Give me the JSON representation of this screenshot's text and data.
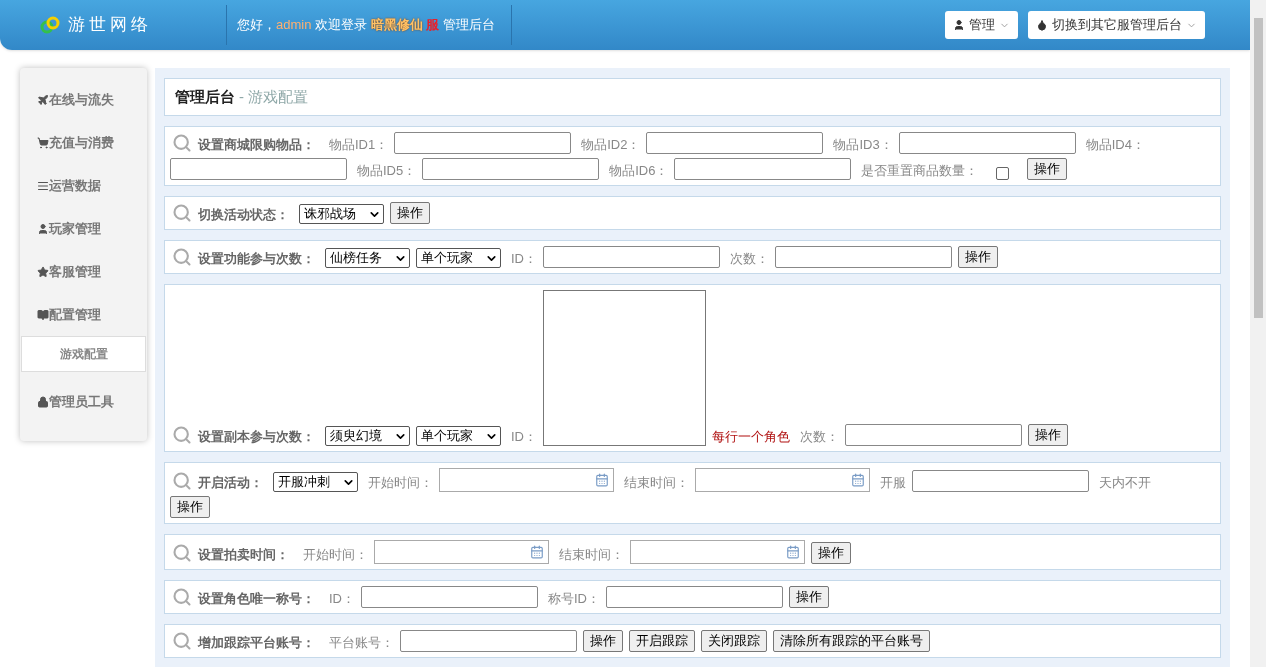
{
  "header": {
    "logo": "游世网络",
    "greeting": [
      {
        "kind": "plain",
        "text": "您好，"
      },
      {
        "kind": "user",
        "text": "admin"
      },
      {
        "kind": "plain",
        "text": " 欢迎登录 "
      },
      {
        "kind": "server",
        "text": "暗黑修仙"
      },
      {
        "kind": "alert",
        "text": " 服"
      },
      {
        "kind": "plain",
        "text": " 管理后台"
      }
    ],
    "menus": [
      "管理",
      "切换到其它服管理后台"
    ]
  },
  "sidebar": {
    "items": [
      {
        "label": "在线与流失",
        "selected": false
      },
      {
        "label": "充值与消费",
        "selected": false
      },
      {
        "label": "运营数据",
        "selected": false
      },
      {
        "label": "玩家管理",
        "selected": false
      },
      {
        "label": "客服管理",
        "selected": false
      },
      {
        "label": "配置管理",
        "selected": false,
        "children": [
          {
            "label": "游戏配置",
            "selected": true
          }
        ]
      },
      {
        "label": "管理员工具",
        "selected": false
      }
    ]
  },
  "breadcrumb": {
    "root": "管理后台",
    "current": "- 游戏配置"
  },
  "forms": [
    {
      "title": "设置商城限购物品：",
      "items": [
        {
          "kind": "label",
          "text": "物品ID1："
        },
        {
          "kind": "input"
        },
        {
          "kind": "label",
          "text": "物品ID2："
        },
        {
          "kind": "input"
        },
        {
          "kind": "label",
          "text": "物品ID3："
        },
        {
          "kind": "input"
        },
        {
          "kind": "label",
          "text": "物品ID4："
        },
        {
          "kind": "break"
        },
        {
          "kind": "input"
        },
        {
          "kind": "label",
          "text": "物品ID5："
        },
        {
          "kind": "input"
        },
        {
          "kind": "label",
          "text": "物品ID6："
        },
        {
          "kind": "input"
        },
        {
          "kind": "label",
          "text": "是否重置商品数量："
        },
        {
          "kind": "checkbox",
          "checked": false
        },
        {
          "kind": "button",
          "text": "操作"
        }
      ]
    },
    {
      "title": "切换活动状态：",
      "items": [
        {
          "kind": "select",
          "text": "诛邪战场"
        },
        {
          "kind": "button",
          "text": "操作"
        }
      ]
    },
    {
      "title": "设置功能参与次数：",
      "items": [
        {
          "kind": "select",
          "text": "仙榜任务"
        },
        {
          "kind": "select",
          "text": "单个玩家"
        },
        {
          "kind": "label",
          "text": "ID："
        },
        {
          "kind": "input"
        },
        {
          "kind": "label",
          "text": "次数："
        },
        {
          "kind": "input"
        },
        {
          "kind": "button",
          "text": "操作"
        }
      ]
    },
    {
      "title": "设置副本参与次数：",
      "items": [
        {
          "kind": "select",
          "text": "须臾幻境"
        },
        {
          "kind": "select",
          "text": "单个玩家"
        },
        {
          "kind": "label",
          "text": "ID："
        },
        {
          "kind": "textarea"
        },
        {
          "kind": "note",
          "text": "每行一个角色"
        },
        {
          "kind": "label",
          "text": "次数："
        },
        {
          "kind": "input"
        },
        {
          "kind": "button",
          "text": "操作"
        }
      ]
    },
    {
      "title": "开启活动：",
      "items": [
        {
          "kind": "select",
          "text": "开服冲刺"
        },
        {
          "kind": "label",
          "text": "开始时间："
        },
        {
          "kind": "date"
        },
        {
          "kind": "label",
          "text": "结束时间："
        },
        {
          "kind": "date"
        },
        {
          "kind": "label",
          "text": "开服"
        },
        {
          "kind": "input"
        },
        {
          "kind": "label",
          "text": "天内不开"
        },
        {
          "kind": "break"
        },
        {
          "kind": "button",
          "text": "操作"
        }
      ]
    },
    {
      "title": "设置拍卖时间：",
      "items": [
        {
          "kind": "label",
          "text": "开始时间："
        },
        {
          "kind": "date"
        },
        {
          "kind": "label",
          "text": "结束时间："
        },
        {
          "kind": "date"
        },
        {
          "kind": "button",
          "text": "操作"
        }
      ]
    },
    {
      "title": "设置角色唯一称号：",
      "items": [
        {
          "kind": "label",
          "text": "ID："
        },
        {
          "kind": "input"
        },
        {
          "kind": "label",
          "text": "称号ID："
        },
        {
          "kind": "input"
        },
        {
          "kind": "button",
          "text": "操作"
        }
      ]
    },
    {
      "title": "增加跟踪平台账号：",
      "items": [
        {
          "kind": "label",
          "text": "平台账号："
        },
        {
          "kind": "input"
        },
        {
          "kind": "button",
          "text": "操作"
        },
        {
          "kind": "button",
          "text": "开启跟踪"
        },
        {
          "kind": "button",
          "text": "关闭跟踪"
        },
        {
          "kind": "button",
          "text": "清除所有跟踪的平台账号"
        }
      ]
    }
  ]
}
